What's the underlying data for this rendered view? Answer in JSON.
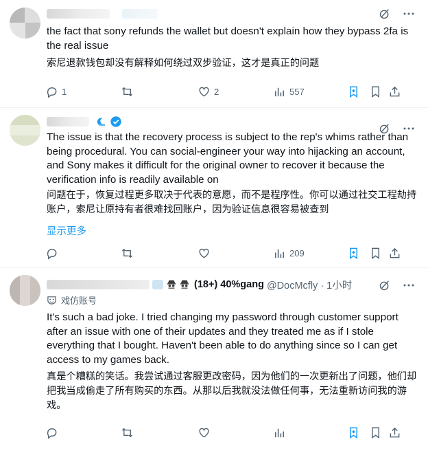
{
  "post1": {
    "text_en": "the fact that sony refunds the wallet but doesn't explain how they bypass 2fa is the real issue",
    "text_zh": "索尼退款钱包却没有解释如何绕过双步验证，这才是真正的问题",
    "replies": "1",
    "reposts": "",
    "likes": "2",
    "views": "557"
  },
  "post2": {
    "text_en": "The issue is that the recovery process is subject to the rep's whims rather than being procedural. You can social-engineer your way into hijacking an account, and Sony makes it difficult for the original owner to recover it because the verification info is readily available on",
    "text_zh": "问题在于，恢复过程更多取决于代表的意愿，而不是程序性。你可以通过社交工程劫持账户，索尼让原持有者很难找回账户，因为验证信息很容易被查到",
    "show_more": "显示更多",
    "replies": "",
    "reposts": "",
    "likes": "",
    "views": "209"
  },
  "post3": {
    "display_name": "(18+) 40%gang",
    "handle_time": "@DocMcfly · 1小时",
    "label": "戏仿账号",
    "text_en": "It's such a bad joke. I tried changing my password through customer support after an issue with one of their updates and they treated me as if I stole everything that I bought. Haven't been able to do anything since so I can get access to my games back.",
    "text_zh": "真是个糟糕的笑话。我尝试通过客服更改密码，因为他们的一次更新出了问题，他们却把我当成偷走了所有购买的东西。从那以后我就没法做任何事，无法重新访问我的游戏。",
    "replies": "",
    "reposts": "",
    "likes": "",
    "views": ""
  },
  "colors": {
    "text": "#0f1419",
    "muted": "#536471",
    "link": "#1d9bf0",
    "bookmark_active": "#1d9bf0"
  },
  "icons": [
    "reply-icon",
    "repost-icon",
    "like-icon",
    "views-icon",
    "grok-bookmark-icon",
    "bookmark-icon",
    "share-icon",
    "grok-icon",
    "more-icon",
    "verified-badge-icon",
    "parody-icon"
  ]
}
